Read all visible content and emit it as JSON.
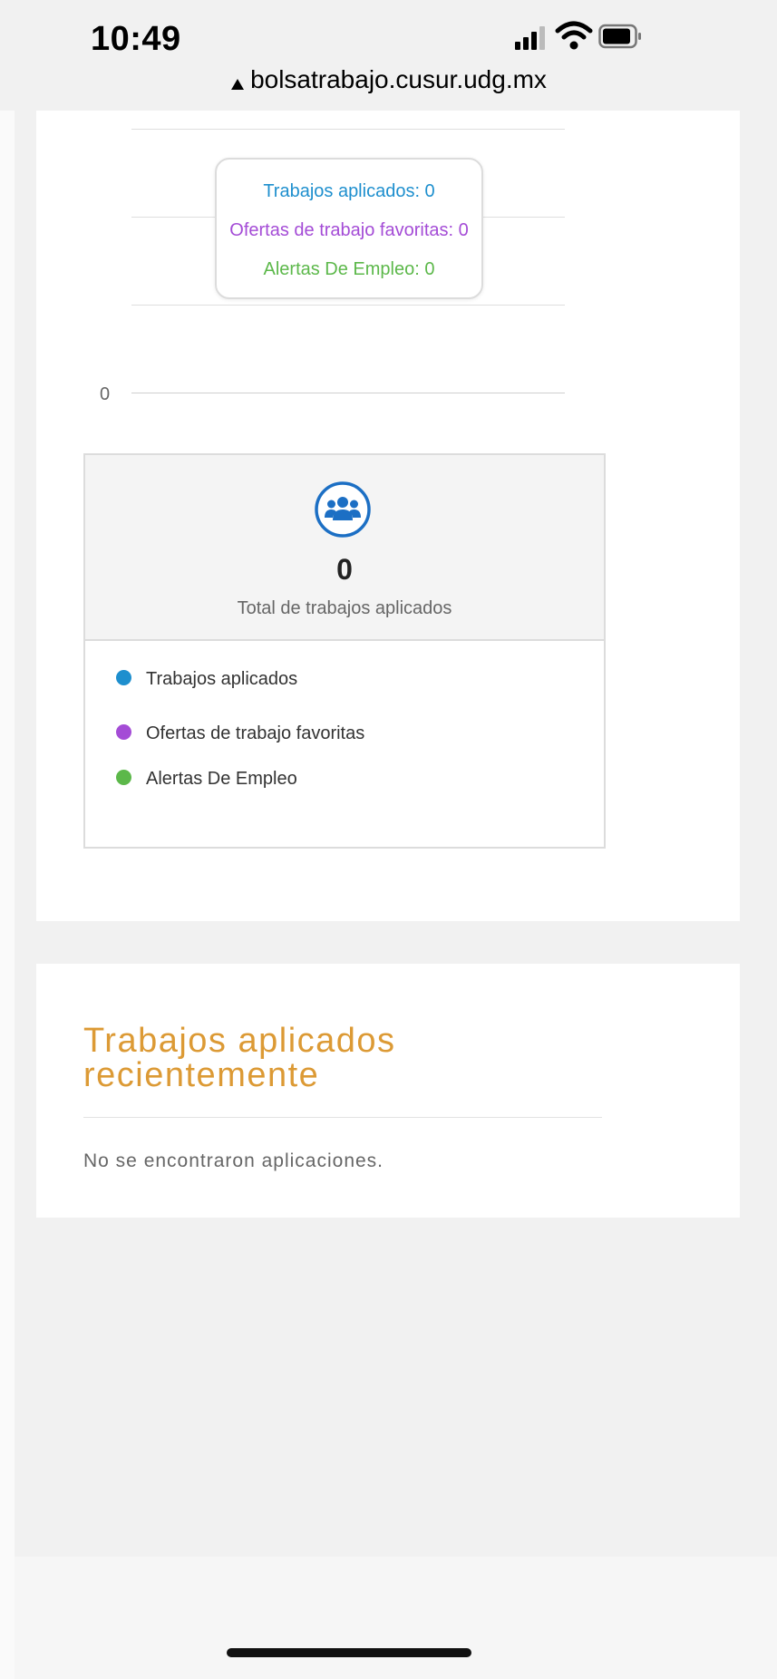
{
  "status_bar": {
    "time": "10:49",
    "signal_icon": "cellular-signal-icon",
    "wifi_icon": "wifi-icon",
    "battery_icon": "battery-icon"
  },
  "browser": {
    "url": "bolsatrabajo.cusur.udg.mx",
    "lock_icon": "lock-icon"
  },
  "chart_data": {
    "type": "bar",
    "tooltip_lines": [
      {
        "label": "Trabajos aplicados: 0",
        "color": "#1e8fce"
      },
      {
        "label": "Ofertas de trabajo favoritas: 0",
        "color": "#a44cd6"
      },
      {
        "label": "Alertas De Empleo: 0",
        "color": "#5cb84a"
      }
    ],
    "y_tick": "0",
    "series": [
      {
        "name": "Trabajos aplicados",
        "values": [
          0
        ]
      },
      {
        "name": "Ofertas de trabajo favoritas",
        "values": [
          0
        ]
      },
      {
        "name": "Alertas De Empleo",
        "values": [
          0
        ]
      }
    ]
  },
  "stats": {
    "icon": "users-group-icon",
    "total_value": "0",
    "total_label": "Total de trabajos aplicados"
  },
  "legend": [
    {
      "label": "Trabajos aplicados",
      "color": "#1e8fce"
    },
    {
      "label": "Ofertas de trabajo favoritas",
      "color": "#a44cd6"
    },
    {
      "label": "Alertas De Empleo",
      "color": "#5cb84a"
    }
  ],
  "recent": {
    "title_line1": "Trabajos aplicados",
    "title_line2": "recientemente",
    "empty_message": "No se encontraron aplicaciones."
  },
  "colors": {
    "accent_title": "#dc9a35",
    "icon_blue": "#1c6fc4"
  }
}
